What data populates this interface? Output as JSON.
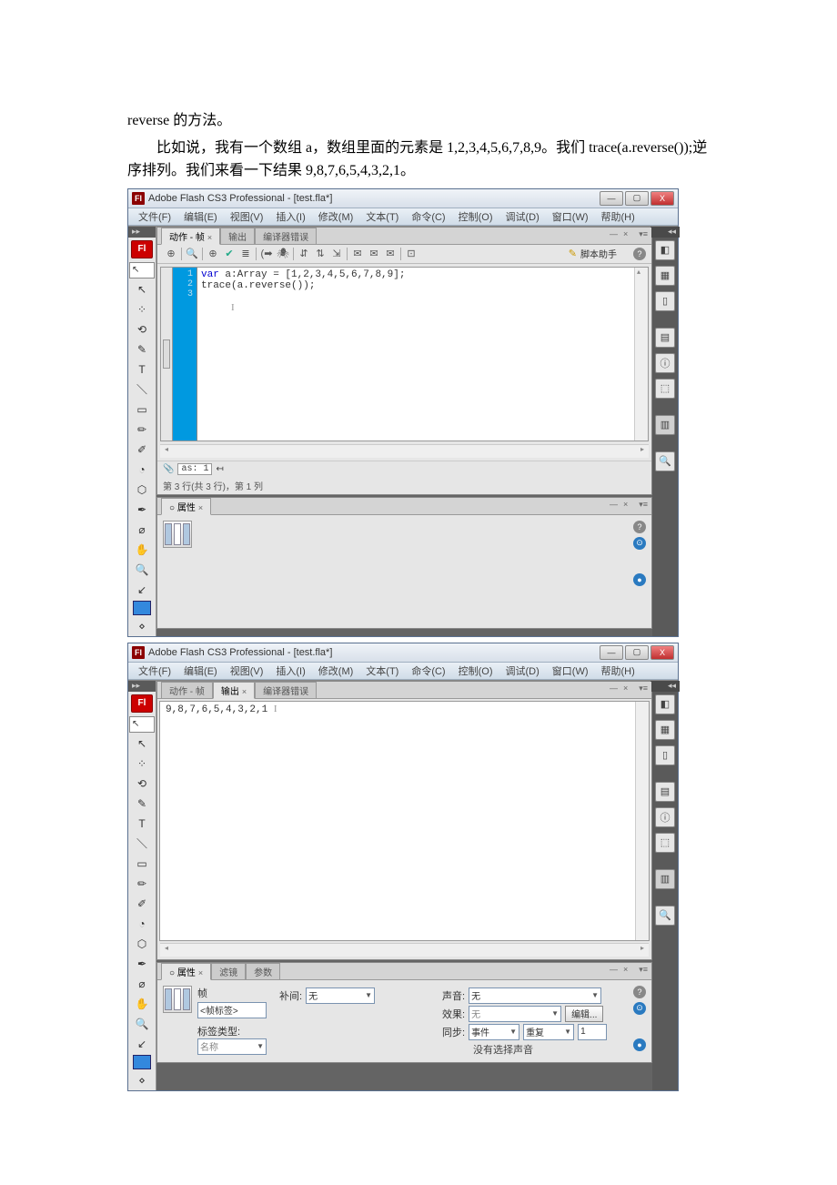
{
  "doc": {
    "line1_prefix": "reverse",
    "line1_suffix": " 的方法。",
    "line2": "比如说，我有一个数组 a，数组里面的元素是 1,2,3,4,5,6,7,8,9。我们 trace(a.reverse());逆序排列。我们来看一下结果 9,8,7,6,5,4,3,2,1。"
  },
  "app": {
    "title": "Adobe Flash CS3 Professional - [test.fla*]",
    "fl_logo": "Fl",
    "menu": [
      "文件(F)",
      "编辑(E)",
      "视图(V)",
      "插入(I)",
      "修改(M)",
      "文本(T)",
      "命令(C)",
      "控制(O)",
      "调试(D)",
      "窗口(W)",
      "帮助(H)"
    ],
    "win_btns": {
      "min": "—",
      "max": "▢",
      "close": "X"
    }
  },
  "window1": {
    "tabs": {
      "actions": "动作 - 帧",
      "output": "输出",
      "errors": "编译器错误"
    },
    "script_help_icon": "✎",
    "script_help": "脚本助手",
    "help_icon": "?",
    "code": {
      "lines": [
        "1",
        "2",
        "3"
      ],
      "l1a": "var",
      "l1b": " a:Array = [1,2,3,4,5,6,7,8,9];",
      "l2": "trace(a.reverse());"
    },
    "footer_as": "as: 1",
    "status": "第 3 行(共 3 行)，第 1 列",
    "props_tab": "属性"
  },
  "window2": {
    "tabs": {
      "actions": "动作 - 帧",
      "output": "输出",
      "errors": "编译器错误"
    },
    "output": "9,8,7,6,5,4,3,2,1",
    "props": {
      "tab_props": "属性",
      "tab_filter": "滤镜",
      "tab_param": "参数",
      "frame_label": "帧",
      "frame_tag_label": "<帧标签>",
      "tween_label": "补间:",
      "tween_val": "无",
      "label_type": "标签类型:",
      "label_type_val": "名称",
      "sound_label": "声音:",
      "sound_val": "无",
      "effect_label": "效果:",
      "effect_val": "无",
      "edit_btn": "编辑...",
      "sync_label": "同步:",
      "sync_val": "事件",
      "repeat_val": "重复",
      "count": "1",
      "no_sound": "没有选择声音"
    }
  },
  "tools": [
    "↖",
    "↖",
    "⁘",
    "⟲",
    "✎",
    "T",
    "＼",
    "▭",
    "✏",
    "✐",
    "◔",
    "⬡",
    "✒",
    "⌀",
    "✋",
    "🔍",
    "↙"
  ],
  "rtools": [
    "◧",
    "▦",
    "▯",
    "▤",
    "ⓘ",
    "⬚",
    "▥",
    "🔍"
  ]
}
